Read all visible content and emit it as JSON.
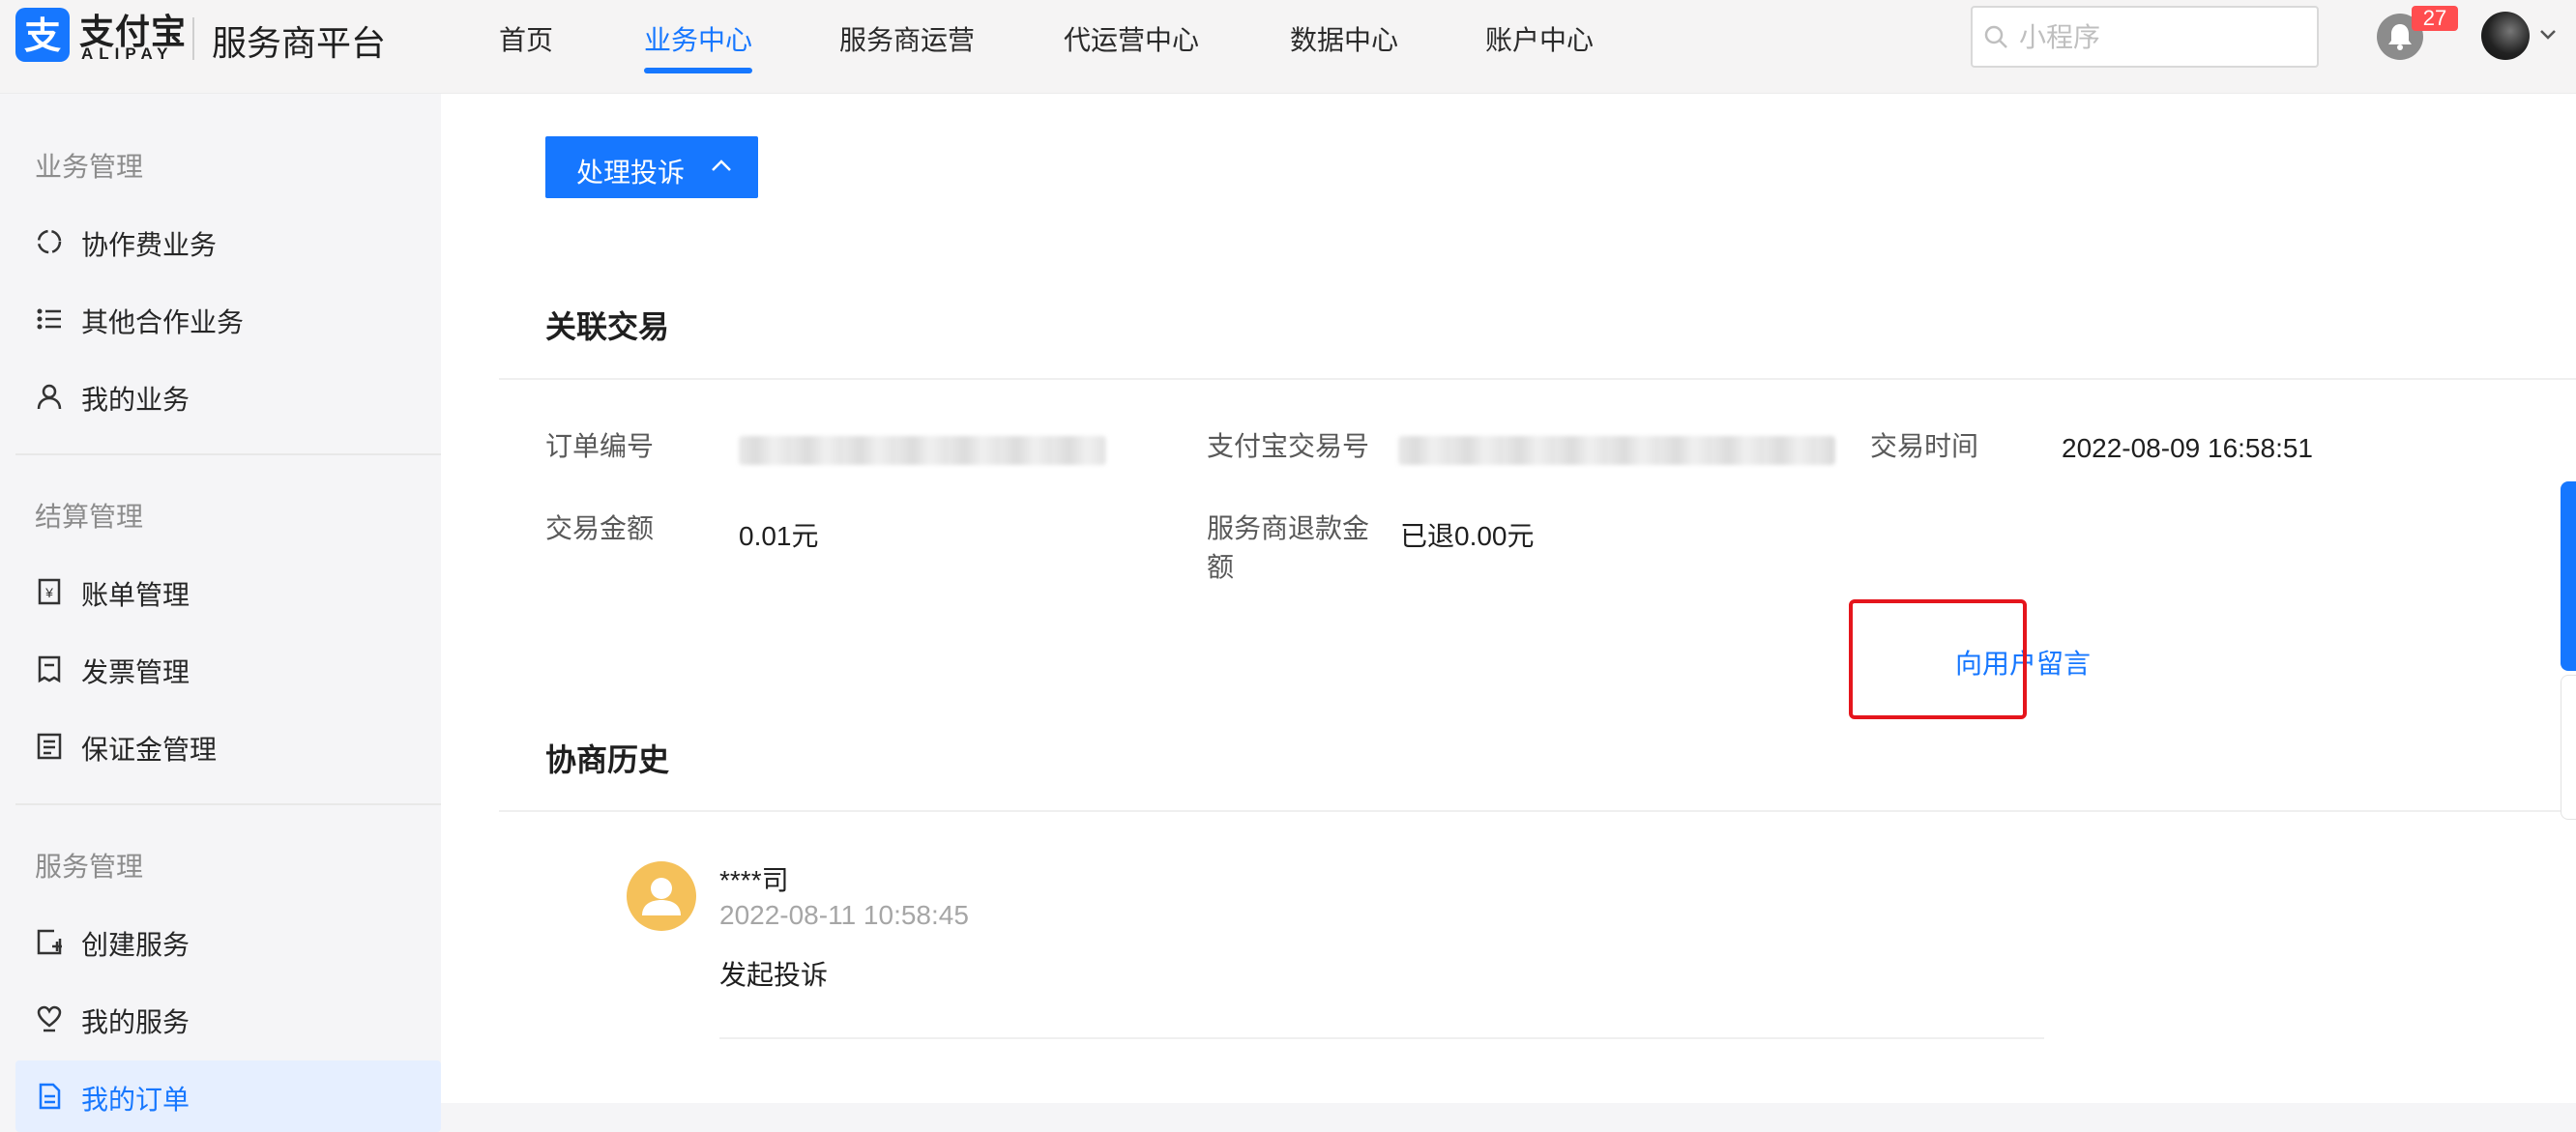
{
  "header": {
    "logo_cn": "支付宝",
    "logo_en": "ALIPAY",
    "platform": "服务商平台",
    "nav": [
      "首页",
      "业务中心",
      "服务商运营",
      "代运营中心",
      "数据中心",
      "账户中心"
    ],
    "active_nav": "业务中心",
    "search_placeholder": "小程序",
    "notification_count": "27"
  },
  "sidebar": {
    "groups": [
      {
        "title": "业务管理",
        "items": [
          "协作费业务",
          "其他合作业务",
          "我的业务"
        ]
      },
      {
        "title": "结算管理",
        "items": [
          "账单管理",
          "发票管理",
          "保证金管理"
        ]
      },
      {
        "title": "服务管理",
        "items": [
          "创建服务",
          "我的服务",
          "我的订单"
        ]
      }
    ],
    "active_item": "我的订单"
  },
  "main": {
    "handle_button": "处理投诉",
    "related_title": "关联交易",
    "fields": {
      "order_no_label": "订单编号",
      "alipay_trade_label": "支付宝交易号",
      "trade_time_label": "交易时间",
      "trade_time_value": "2022-08-09 16:58:51",
      "amount_label": "交易金额",
      "amount_value": "0.01元",
      "refund_label": "服务商退款金额",
      "refund_value": "已退0.00元"
    },
    "history_title": "协商历史",
    "message_link": "向用户留言",
    "history": [
      {
        "name": "****司",
        "time": "2022-08-11 10:58:45",
        "text": "发起投诉"
      }
    ]
  },
  "colors": {
    "accent": "#1677ff",
    "highlight": "#e5151c",
    "badge": "#ff4d4f"
  }
}
